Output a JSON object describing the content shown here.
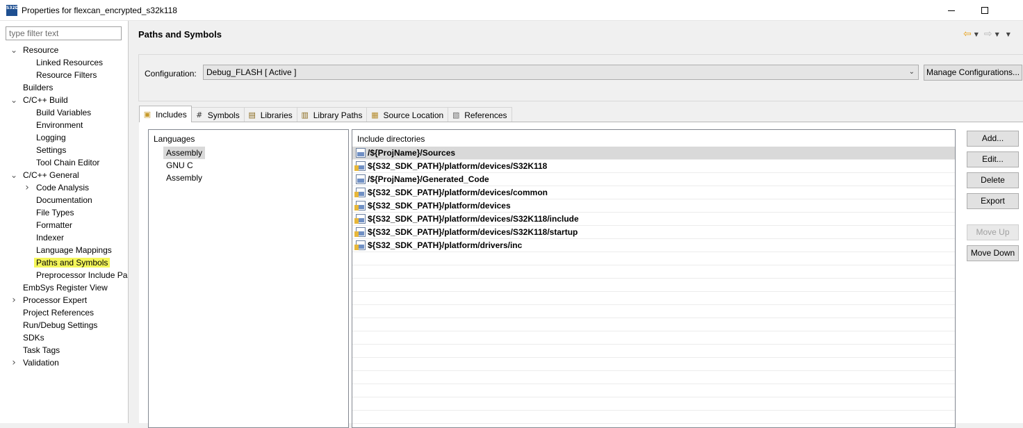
{
  "window": {
    "title": "Properties for flexcan_encrypted_s32k118",
    "app_icon_text": "S32DS"
  },
  "nav": {
    "filter_placeholder": "type filter text",
    "items": [
      {
        "label": "Resource",
        "level": 0,
        "arrow": "expanded"
      },
      {
        "label": "Linked Resources",
        "level": 1
      },
      {
        "label": "Resource Filters",
        "level": 1
      },
      {
        "label": "Builders",
        "level": 0
      },
      {
        "label": "C/C++ Build",
        "level": 0,
        "arrow": "expanded"
      },
      {
        "label": "Build Variables",
        "level": 1
      },
      {
        "label": "Environment",
        "level": 1
      },
      {
        "label": "Logging",
        "level": 1
      },
      {
        "label": "Settings",
        "level": 1
      },
      {
        "label": "Tool Chain Editor",
        "level": 1
      },
      {
        "label": "C/C++ General",
        "level": 0,
        "arrow": "expanded"
      },
      {
        "label": "Code Analysis",
        "level": 1,
        "arrow": "collapsed"
      },
      {
        "label": "Documentation",
        "level": 1
      },
      {
        "label": "File Types",
        "level": 1
      },
      {
        "label": "Formatter",
        "level": 1
      },
      {
        "label": "Indexer",
        "level": 1
      },
      {
        "label": "Language Mappings",
        "level": 1
      },
      {
        "label": "Paths and Symbols",
        "level": 1,
        "highlighted": true
      },
      {
        "label": "Preprocessor Include Pa",
        "level": 1
      },
      {
        "label": "EmbSys Register View",
        "level": 0
      },
      {
        "label": "Processor Expert",
        "level": 0,
        "arrow": "collapsed"
      },
      {
        "label": "Project References",
        "level": 0
      },
      {
        "label": "Run/Debug Settings",
        "level": 0
      },
      {
        "label": "SDKs",
        "level": 0
      },
      {
        "label": "Task Tags",
        "level": 0
      },
      {
        "label": "Validation",
        "level": 0,
        "arrow": "collapsed"
      }
    ],
    "highlight_color": "#f4f65a"
  },
  "page": {
    "title": "Paths and Symbols",
    "config_label": "Configuration:",
    "config_value": "Debug_FLASH  [ Active ]",
    "manage_button": "Manage Configurations..."
  },
  "tabs": [
    {
      "label": "Includes",
      "icon": "includes-icon",
      "active": true
    },
    {
      "label": "Symbols",
      "icon": "hash-icon"
    },
    {
      "label": "Libraries",
      "icon": "libraries-icon"
    },
    {
      "label": "Library Paths",
      "icon": "library-paths-icon"
    },
    {
      "label": "Source Location",
      "icon": "source-location-icon"
    },
    {
      "label": "References",
      "icon": "references-icon"
    }
  ],
  "languages": {
    "header": "Languages",
    "items": [
      {
        "label": "Assembly",
        "selected": true
      },
      {
        "label": "GNU C"
      },
      {
        "label": "Assembly"
      }
    ]
  },
  "includes": {
    "header": "Include directories",
    "items": [
      {
        "path": "/${ProjName}/Sources",
        "selected": true,
        "icon": "workspace-folder-icon"
      },
      {
        "path": "${S32_SDK_PATH}/platform/devices/S32K118",
        "icon": "filesystem-folder-icon"
      },
      {
        "path": "/${ProjName}/Generated_Code",
        "icon": "workspace-folder-icon"
      },
      {
        "path": "${S32_SDK_PATH}/platform/devices/common",
        "icon": "filesystem-folder-icon"
      },
      {
        "path": "${S32_SDK_PATH}/platform/devices",
        "icon": "filesystem-folder-icon"
      },
      {
        "path": "${S32_SDK_PATH}/platform/devices/S32K118/include",
        "icon": "filesystem-folder-icon"
      },
      {
        "path": "${S32_SDK_PATH}/platform/devices/S32K118/startup",
        "icon": "filesystem-folder-icon"
      },
      {
        "path": "${S32_SDK_PATH}/platform/drivers/inc",
        "icon": "filesystem-folder-icon"
      }
    ]
  },
  "buttons": {
    "add": "Add...",
    "edit": "Edit...",
    "delete": "Delete",
    "export": "Export",
    "move_up": "Move Up",
    "move_down": "Move Down"
  }
}
